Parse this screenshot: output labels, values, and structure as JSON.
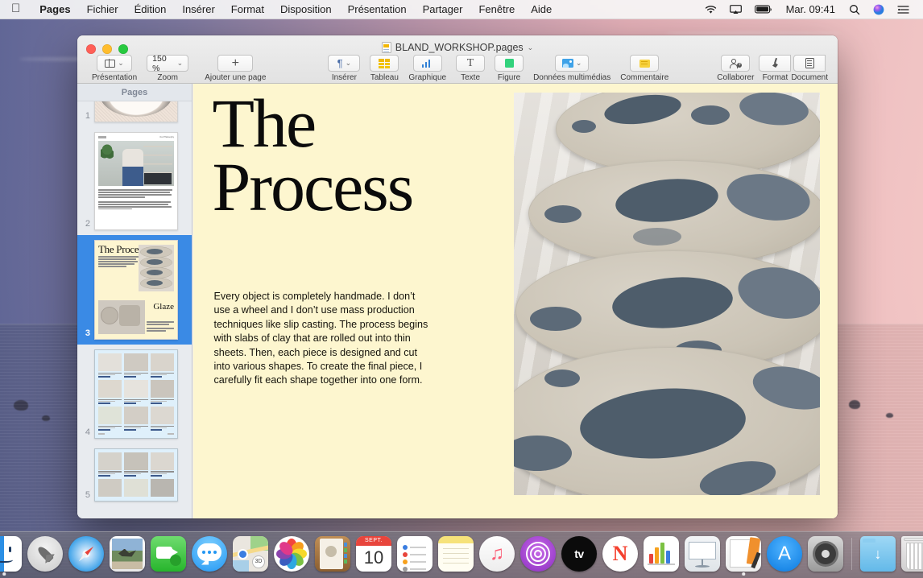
{
  "menubar": {
    "apple_icon": "apple-logo-icon",
    "items": [
      {
        "label": "Pages",
        "bold": true
      },
      {
        "label": "Fichier",
        "bold": false
      },
      {
        "label": "Édition",
        "bold": false
      },
      {
        "label": "Insérer",
        "bold": false
      },
      {
        "label": "Format",
        "bold": false
      },
      {
        "label": "Disposition",
        "bold": false
      },
      {
        "label": "Présentation",
        "bold": false
      },
      {
        "label": "Partager",
        "bold": false
      },
      {
        "label": "Fenêtre",
        "bold": false
      },
      {
        "label": "Aide",
        "bold": false
      }
    ],
    "status": {
      "wifi_icon": "wifi-icon",
      "airplay_icon": "airplay-icon",
      "battery_icon": "battery-icon",
      "clock": "Mar. 09:41",
      "search_icon": "search-icon",
      "siri_icon": "siri-icon",
      "control_center_icon": "control-center-icon"
    }
  },
  "window": {
    "title": "BLAND_WORKSHOP.pages",
    "title_chevron": "⌄",
    "traffic_lights": {
      "close": "close-button",
      "minimize": "minimize-button",
      "maximize": "maximize-button"
    },
    "toolbar": {
      "view_label": "Présentation",
      "zoom_label": "Zoom",
      "zoom_value": "150 %",
      "add_page_label": "Ajouter une page",
      "insert_label": "Insérer",
      "table_label": "Tableau",
      "chart_label": "Graphique",
      "text_label": "Texte",
      "shape_label": "Figure",
      "media_label": "Données multimédias",
      "comment_label": "Commentaire",
      "collaborate_label": "Collaborer",
      "format_label": "Format",
      "document_label": "Document"
    }
  },
  "sidebar": {
    "header": "Pages",
    "selected_page": 3,
    "pages": [
      {
        "number": "1"
      },
      {
        "number": "2"
      },
      {
        "number": "3"
      },
      {
        "number": "4"
      },
      {
        "number": "5"
      }
    ]
  },
  "document": {
    "heading_line1": "The",
    "heading_line2": "Process",
    "body": "Every object is completely handmade. I don’t use a wheel and I don’t use mass production techniques like slip casting. The process begins with slabs of clay that are rolled out into thin sheets. Then, each piece is designed and cut into various shapes. To create the final piece, I carefully fit each shape together into one form.",
    "background_color": "#fdf6cf",
    "photo_alt": "ceramic-plates-photo"
  },
  "thumbnails": {
    "page2_kicker": "Our Philosophy",
    "page3_heading": "The Process",
    "page3_subheading": "Glaze"
  },
  "dock": {
    "items": [
      {
        "name": "finder",
        "label": "Finder",
        "running": true
      },
      {
        "name": "launchpad",
        "label": "Launchpad",
        "running": false
      },
      {
        "name": "safari",
        "label": "Safari",
        "running": false
      },
      {
        "name": "mail",
        "label": "Mail",
        "running": false
      },
      {
        "name": "facetime",
        "label": "FaceTime",
        "running": false
      },
      {
        "name": "messages",
        "label": "Messages",
        "running": false
      },
      {
        "name": "maps",
        "label": "Plans",
        "running": false
      },
      {
        "name": "photos",
        "label": "Photos",
        "running": false
      },
      {
        "name": "contacts",
        "label": "Contacts",
        "running": false
      },
      {
        "name": "calendar",
        "label": "Calendrier",
        "running": false,
        "month": "SEPT.",
        "day": "10"
      },
      {
        "name": "reminders",
        "label": "Rappels",
        "running": false
      },
      {
        "name": "notes",
        "label": "Notes",
        "running": false
      },
      {
        "name": "music",
        "label": "Musique",
        "running": false
      },
      {
        "name": "podcasts",
        "label": "Podcasts",
        "running": false
      },
      {
        "name": "appletv",
        "label": "Apple TV",
        "running": false,
        "text": "tv"
      },
      {
        "name": "news",
        "label": "News",
        "running": false,
        "text": "N"
      },
      {
        "name": "numbers",
        "label": "Numbers",
        "running": false
      },
      {
        "name": "keynote",
        "label": "Keynote",
        "running": false
      },
      {
        "name": "pages",
        "label": "Pages",
        "running": true
      },
      {
        "name": "appstore",
        "label": "App Store",
        "running": false,
        "text": "A"
      },
      {
        "name": "systempreferences",
        "label": "Préférences Système",
        "running": false
      },
      {
        "name": "downloads",
        "label": "Téléchargements",
        "running": false
      },
      {
        "name": "trash",
        "label": "Corbeille",
        "running": false
      }
    ]
  },
  "colors": {
    "selection_blue": "#3a8ae5",
    "page_cream": "#fdf6cf",
    "toolbar_grey": "#ececec",
    "sidebar_grey": "#e8ebef"
  }
}
